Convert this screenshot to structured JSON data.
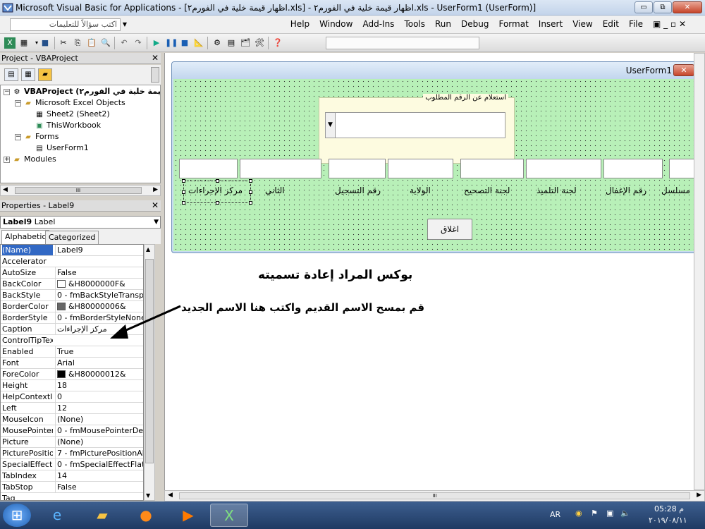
{
  "window": {
    "title": "Microsoft Visual Basic for Applications - [اظهار قيمة خلية في الفورم٢.xls] - اظهار قيمة خلية في الفورم٢.xls - UserForm1 (UserForm)]",
    "btn_min": "▭",
    "btn_max": "⧉",
    "btn_close": "✕"
  },
  "menubar": {
    "ask_placeholder": "اكتب سؤالاً للتعليمات",
    "items": [
      "Help",
      "Window",
      "Add-Ins",
      "Tools",
      "Run",
      "Debug",
      "Format",
      "Insert",
      "View",
      "Edit",
      "File"
    ],
    "tail": "▣ _ ▫ ✕"
  },
  "project": {
    "header": "Project - VBAProject",
    "close": "✕",
    "tree": {
      "root": "VBAProject (قيمة خلية في الفورم٢)",
      "root_prefix": "قيمة خلية في الفورم٢)",
      "excel_objects": "Microsoft Excel Objects",
      "sheet2": "Sheet2 (Sheet2)",
      "thisworkbook": "ThisWorkbook",
      "forms": "Forms",
      "userform1": "UserForm1",
      "modules": "Modules"
    },
    "scroll_mark": "III"
  },
  "properties": {
    "header": "Properties - Label9",
    "close": "✕",
    "object_name": "Label9",
    "object_type": "Label",
    "tabs": [
      "Alphabetic",
      "Categorized"
    ],
    "rows": [
      {
        "name": "(Name)",
        "value": "Label9"
      },
      {
        "name": "Accelerator",
        "value": ""
      },
      {
        "name": "AutoSize",
        "value": "False"
      },
      {
        "name": "BackColor",
        "value": "&H8000000F&"
      },
      {
        "name": "BackStyle",
        "value": "0 - fmBackStyleTransparent"
      },
      {
        "name": "BorderColor",
        "value": "&H80000006&"
      },
      {
        "name": "BorderStyle",
        "value": "0 - fmBorderStyleNone"
      },
      {
        "name": "Caption",
        "value": "مركز الإجراءات"
      },
      {
        "name": "ControlTipText",
        "value": ""
      },
      {
        "name": "Enabled",
        "value": "True"
      },
      {
        "name": "Font",
        "value": "Arial"
      },
      {
        "name": "ForeColor",
        "value": "&H80000012&"
      },
      {
        "name": "Height",
        "value": "18"
      },
      {
        "name": "HelpContextID",
        "value": "0"
      },
      {
        "name": "Left",
        "value": "12"
      },
      {
        "name": "MouseIcon",
        "value": "(None)"
      },
      {
        "name": "MousePointer",
        "value": "0 - fmMousePointerDefault"
      },
      {
        "name": "Picture",
        "value": "(None)"
      },
      {
        "name": "PicturePosition",
        "value": "7 - fmPicturePositionAbove"
      },
      {
        "name": "SpecialEffect",
        "value": "0 - fmSpecialEffectFlat"
      },
      {
        "name": "TabIndex",
        "value": "14"
      },
      {
        "name": "TabStop",
        "value": "False"
      },
      {
        "name": "Tag",
        "value": ""
      }
    ]
  },
  "userform": {
    "title": "UserForm1",
    "close": "✕",
    "frame_caption": "استعلام عن الرقم المطلوب",
    "labels": [
      "مسلسل",
      "رقم الإغفال",
      "لجنة التلميذ",
      "لجنة التصحيح",
      "الولاية",
      "رقم التسجيل",
      "الثاني",
      "مركز الإجراءات"
    ],
    "close_button": "اغلاق"
  },
  "annotations": {
    "line1": "بوكس المراد إعادة تسميته",
    "line2": "قم بمسح الاسم القديم واكتب هنا الاسم الجديد"
  },
  "taskbar": {
    "lang": "AR",
    "time": "05:28 م",
    "date": "٢٠١٩/٠٨/١١"
  },
  "colors": {
    "canvas_green": "#b8f0b8",
    "selection_blue": "#3168c4"
  }
}
